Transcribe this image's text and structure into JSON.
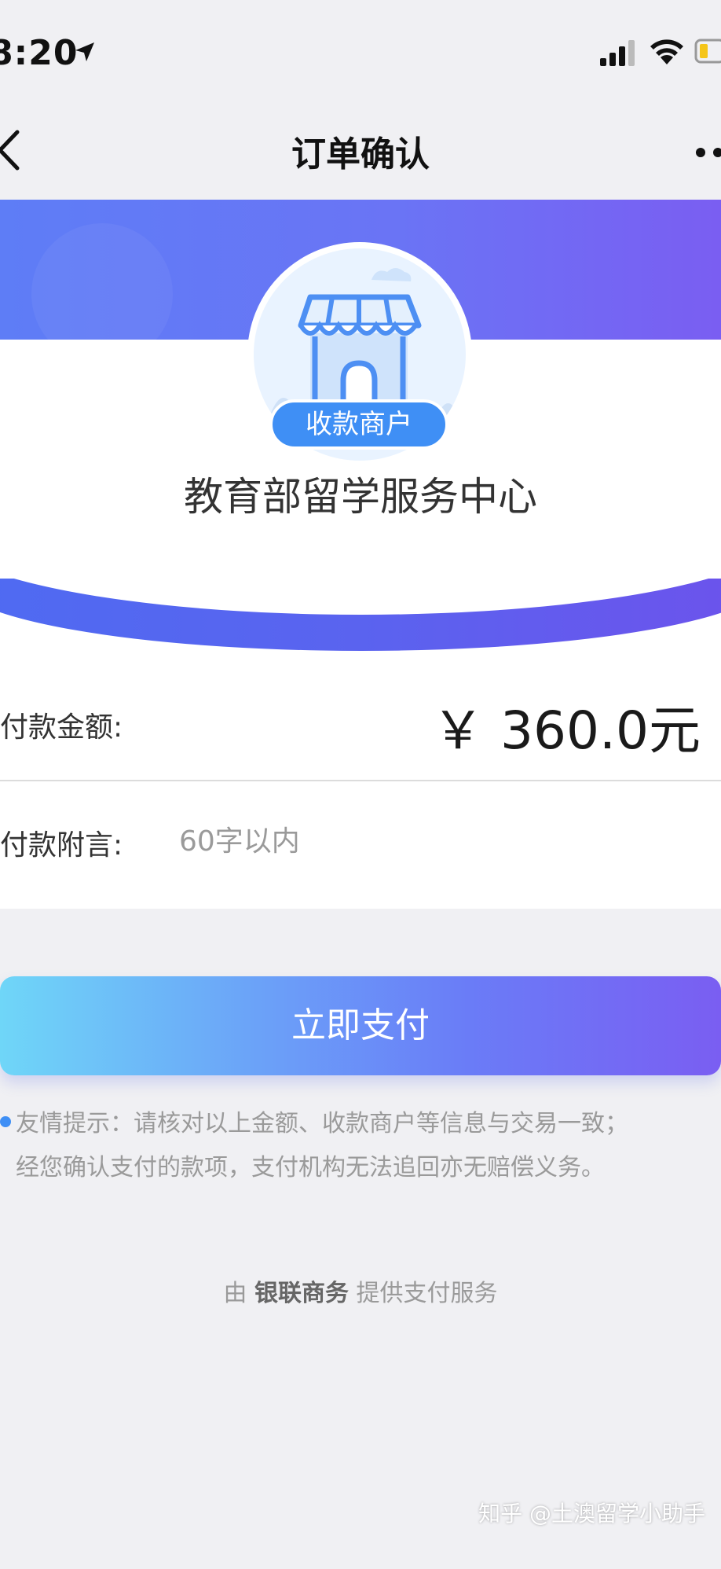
{
  "status_bar": {
    "time": "8:20",
    "icons": [
      "location-arrow-icon",
      "cellular-signal-icon",
      "wifi-icon",
      "battery-icon"
    ]
  },
  "nav": {
    "title": "订单确认",
    "back_icon": "chevron-left-icon",
    "more_icon": "more-dots-icon"
  },
  "merchant": {
    "badge": "收款商户",
    "name": "教育部留学服务中心",
    "icon": "storefront-icon"
  },
  "payment": {
    "amount_label": "付款金额:",
    "amount_value": "￥ 360.0元",
    "note_label": "付款附言:",
    "note_value": "",
    "note_placeholder": "60字以内"
  },
  "pay_button": {
    "label": "立即支付"
  },
  "tip": {
    "line1": "友情提示：请核对以上金额、收款商户等信息与交易一致；",
    "line2": "经您确认支付的款项，支付机构无法追回亦无赔偿义务。"
  },
  "provider": {
    "prefix": "由",
    "name": "银联商务",
    "suffix": "提供支付服务"
  },
  "watermark": "知乎 @土澳留学小助手",
  "colors": {
    "accent_blue": "#3f8ff5",
    "header_gradient_start": "#5e7df6",
    "header_gradient_end": "#7a5ef2",
    "button_gradient_start": "#6fd6f8",
    "button_gradient_end": "#7a5ef2"
  }
}
